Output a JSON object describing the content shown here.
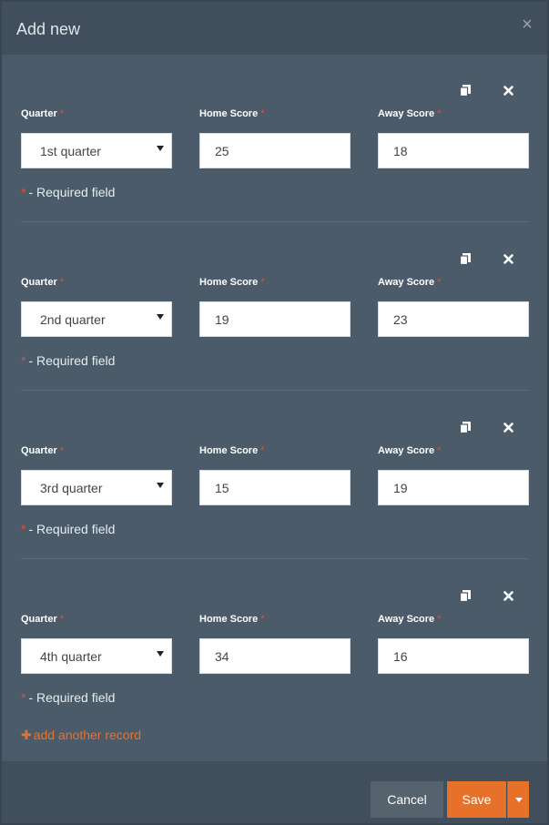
{
  "modal": {
    "title": "Add new",
    "close_icon": "close-icon"
  },
  "labels": {
    "quarter": "Quarter",
    "home_score": "Home Score",
    "away_score": "Away Score",
    "required_star": "*",
    "required_note": "- Required field"
  },
  "records": [
    {
      "quarter": "1st quarter",
      "home_score": "25",
      "away_score": "18"
    },
    {
      "quarter": "2nd quarter",
      "home_score": "19",
      "away_score": "23"
    },
    {
      "quarter": "3rd quarter",
      "home_score": "15",
      "away_score": "19"
    },
    {
      "quarter": "4th quarter",
      "home_score": "34",
      "away_score": "16"
    }
  ],
  "add_record": {
    "label": "add another record",
    "icon": "plus-icon"
  },
  "footer": {
    "cancel_label": "Cancel",
    "save_label": "Save",
    "save_dropdown_icon": "caret-down-icon"
  },
  "colors": {
    "accent": "#e8712a",
    "required": "#e74c3c",
    "panel": "#4b5b6a",
    "header": "#414e5b"
  }
}
